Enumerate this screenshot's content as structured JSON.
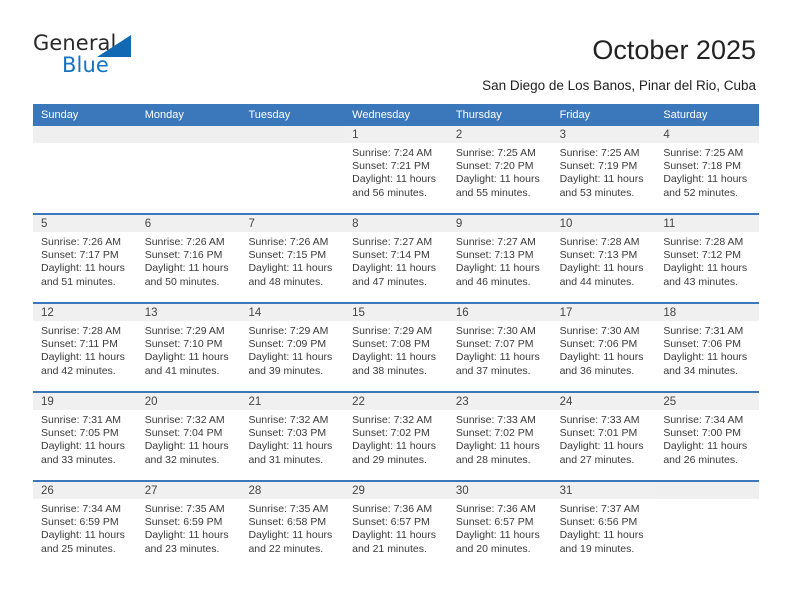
{
  "brand": {
    "word_one": "General",
    "word_two": "Blue",
    "accent_color": "#1268b3",
    "text_color": "#2a2a2a"
  },
  "header": {
    "title": "October 2025",
    "subtitle": "San Diego de Los Banos, Pinar del Rio, Cuba"
  },
  "calendar": {
    "header_bg": "#3b77bb",
    "header_text_color": "#ffffff",
    "daynum_band_bg": "#f0f0f0",
    "day_names": [
      "Sunday",
      "Monday",
      "Tuesday",
      "Wednesday",
      "Thursday",
      "Friday",
      "Saturday"
    ],
    "weeks": [
      [
        {
          "day": "",
          "sunrise": "",
          "sunset": "",
          "daylight_1": "",
          "daylight_2": "",
          "empty": true
        },
        {
          "day": "",
          "sunrise": "",
          "sunset": "",
          "daylight_1": "",
          "daylight_2": "",
          "empty": true
        },
        {
          "day": "",
          "sunrise": "",
          "sunset": "",
          "daylight_1": "",
          "daylight_2": "",
          "empty": true
        },
        {
          "day": "1",
          "sunrise": "Sunrise: 7:24 AM",
          "sunset": "Sunset: 7:21 PM",
          "daylight_1": "Daylight: 11 hours",
          "daylight_2": "and 56 minutes."
        },
        {
          "day": "2",
          "sunrise": "Sunrise: 7:25 AM",
          "sunset": "Sunset: 7:20 PM",
          "daylight_1": "Daylight: 11 hours",
          "daylight_2": "and 55 minutes."
        },
        {
          "day": "3",
          "sunrise": "Sunrise: 7:25 AM",
          "sunset": "Sunset: 7:19 PM",
          "daylight_1": "Daylight: 11 hours",
          "daylight_2": "and 53 minutes."
        },
        {
          "day": "4",
          "sunrise": "Sunrise: 7:25 AM",
          "sunset": "Sunset: 7:18 PM",
          "daylight_1": "Daylight: 11 hours",
          "daylight_2": "and 52 minutes."
        }
      ],
      [
        {
          "day": "5",
          "sunrise": "Sunrise: 7:26 AM",
          "sunset": "Sunset: 7:17 PM",
          "daylight_1": "Daylight: 11 hours",
          "daylight_2": "and 51 minutes."
        },
        {
          "day": "6",
          "sunrise": "Sunrise: 7:26 AM",
          "sunset": "Sunset: 7:16 PM",
          "daylight_1": "Daylight: 11 hours",
          "daylight_2": "and 50 minutes."
        },
        {
          "day": "7",
          "sunrise": "Sunrise: 7:26 AM",
          "sunset": "Sunset: 7:15 PM",
          "daylight_1": "Daylight: 11 hours",
          "daylight_2": "and 48 minutes."
        },
        {
          "day": "8",
          "sunrise": "Sunrise: 7:27 AM",
          "sunset": "Sunset: 7:14 PM",
          "daylight_1": "Daylight: 11 hours",
          "daylight_2": "and 47 minutes."
        },
        {
          "day": "9",
          "sunrise": "Sunrise: 7:27 AM",
          "sunset": "Sunset: 7:13 PM",
          "daylight_1": "Daylight: 11 hours",
          "daylight_2": "and 46 minutes."
        },
        {
          "day": "10",
          "sunrise": "Sunrise: 7:28 AM",
          "sunset": "Sunset: 7:13 PM",
          "daylight_1": "Daylight: 11 hours",
          "daylight_2": "and 44 minutes."
        },
        {
          "day": "11",
          "sunrise": "Sunrise: 7:28 AM",
          "sunset": "Sunset: 7:12 PM",
          "daylight_1": "Daylight: 11 hours",
          "daylight_2": "and 43 minutes."
        }
      ],
      [
        {
          "day": "12",
          "sunrise": "Sunrise: 7:28 AM",
          "sunset": "Sunset: 7:11 PM",
          "daylight_1": "Daylight: 11 hours",
          "daylight_2": "and 42 minutes."
        },
        {
          "day": "13",
          "sunrise": "Sunrise: 7:29 AM",
          "sunset": "Sunset: 7:10 PM",
          "daylight_1": "Daylight: 11 hours",
          "daylight_2": "and 41 minutes."
        },
        {
          "day": "14",
          "sunrise": "Sunrise: 7:29 AM",
          "sunset": "Sunset: 7:09 PM",
          "daylight_1": "Daylight: 11 hours",
          "daylight_2": "and 39 minutes."
        },
        {
          "day": "15",
          "sunrise": "Sunrise: 7:29 AM",
          "sunset": "Sunset: 7:08 PM",
          "daylight_1": "Daylight: 11 hours",
          "daylight_2": "and 38 minutes."
        },
        {
          "day": "16",
          "sunrise": "Sunrise: 7:30 AM",
          "sunset": "Sunset: 7:07 PM",
          "daylight_1": "Daylight: 11 hours",
          "daylight_2": "and 37 minutes."
        },
        {
          "day": "17",
          "sunrise": "Sunrise: 7:30 AM",
          "sunset": "Sunset: 7:06 PM",
          "daylight_1": "Daylight: 11 hours",
          "daylight_2": "and 36 minutes."
        },
        {
          "day": "18",
          "sunrise": "Sunrise: 7:31 AM",
          "sunset": "Sunset: 7:06 PM",
          "daylight_1": "Daylight: 11 hours",
          "daylight_2": "and 34 minutes."
        }
      ],
      [
        {
          "day": "19",
          "sunrise": "Sunrise: 7:31 AM",
          "sunset": "Sunset: 7:05 PM",
          "daylight_1": "Daylight: 11 hours",
          "daylight_2": "and 33 minutes."
        },
        {
          "day": "20",
          "sunrise": "Sunrise: 7:32 AM",
          "sunset": "Sunset: 7:04 PM",
          "daylight_1": "Daylight: 11 hours",
          "daylight_2": "and 32 minutes."
        },
        {
          "day": "21",
          "sunrise": "Sunrise: 7:32 AM",
          "sunset": "Sunset: 7:03 PM",
          "daylight_1": "Daylight: 11 hours",
          "daylight_2": "and 31 minutes."
        },
        {
          "day": "22",
          "sunrise": "Sunrise: 7:32 AM",
          "sunset": "Sunset: 7:02 PM",
          "daylight_1": "Daylight: 11 hours",
          "daylight_2": "and 29 minutes."
        },
        {
          "day": "23",
          "sunrise": "Sunrise: 7:33 AM",
          "sunset": "Sunset: 7:02 PM",
          "daylight_1": "Daylight: 11 hours",
          "daylight_2": "and 28 minutes."
        },
        {
          "day": "24",
          "sunrise": "Sunrise: 7:33 AM",
          "sunset": "Sunset: 7:01 PM",
          "daylight_1": "Daylight: 11 hours",
          "daylight_2": "and 27 minutes."
        },
        {
          "day": "25",
          "sunrise": "Sunrise: 7:34 AM",
          "sunset": "Sunset: 7:00 PM",
          "daylight_1": "Daylight: 11 hours",
          "daylight_2": "and 26 minutes."
        }
      ],
      [
        {
          "day": "26",
          "sunrise": "Sunrise: 7:34 AM",
          "sunset": "Sunset: 6:59 PM",
          "daylight_1": "Daylight: 11 hours",
          "daylight_2": "and 25 minutes."
        },
        {
          "day": "27",
          "sunrise": "Sunrise: 7:35 AM",
          "sunset": "Sunset: 6:59 PM",
          "daylight_1": "Daylight: 11 hours",
          "daylight_2": "and 23 minutes."
        },
        {
          "day": "28",
          "sunrise": "Sunrise: 7:35 AM",
          "sunset": "Sunset: 6:58 PM",
          "daylight_1": "Daylight: 11 hours",
          "daylight_2": "and 22 minutes."
        },
        {
          "day": "29",
          "sunrise": "Sunrise: 7:36 AM",
          "sunset": "Sunset: 6:57 PM",
          "daylight_1": "Daylight: 11 hours",
          "daylight_2": "and 21 minutes."
        },
        {
          "day": "30",
          "sunrise": "Sunrise: 7:36 AM",
          "sunset": "Sunset: 6:57 PM",
          "daylight_1": "Daylight: 11 hours",
          "daylight_2": "and 20 minutes."
        },
        {
          "day": "31",
          "sunrise": "Sunrise: 7:37 AM",
          "sunset": "Sunset: 6:56 PM",
          "daylight_1": "Daylight: 11 hours",
          "daylight_2": "and 19 minutes."
        },
        {
          "day": "",
          "sunrise": "",
          "sunset": "",
          "daylight_1": "",
          "daylight_2": "",
          "empty": true
        }
      ]
    ]
  }
}
